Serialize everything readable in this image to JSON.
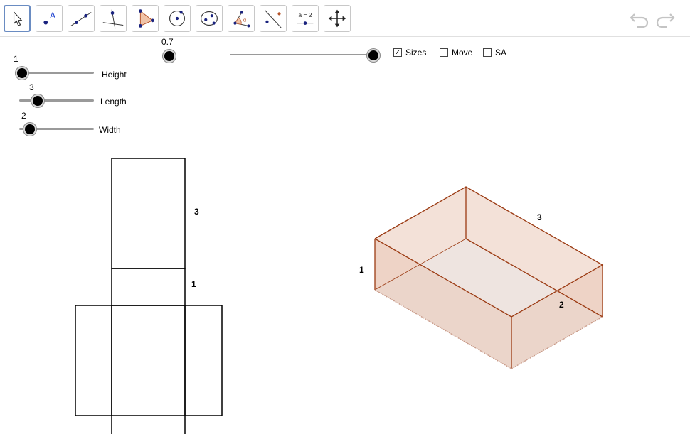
{
  "toolbar": {
    "tools": [
      {
        "name": "move-tool",
        "label": ""
      },
      {
        "name": "point-tool",
        "label": "A"
      },
      {
        "name": "line-tool",
        "label": ""
      },
      {
        "name": "perpendicular-line-tool",
        "label": ""
      },
      {
        "name": "polygon-tool",
        "label": ""
      },
      {
        "name": "circle-tool",
        "label": ""
      },
      {
        "name": "ellipse-tool",
        "label": ""
      },
      {
        "name": "angle-tool",
        "label": "α"
      },
      {
        "name": "reflect-tool",
        "label": ""
      },
      {
        "name": "slider-tool",
        "label": "a = 2"
      },
      {
        "name": "move-graphics-view-tool",
        "label": ""
      }
    ],
    "undo_icon": "undo-icon",
    "redo_icon": "redo-icon"
  },
  "sliders": {
    "height": {
      "label": "Height",
      "value": "1"
    },
    "length": {
      "label": "Length",
      "value": "3"
    },
    "width": {
      "label": "Width",
      "value": "2"
    },
    "unfold": {
      "value": "0.7"
    }
  },
  "checkboxes": {
    "sizes": {
      "label": "Sizes",
      "checked": true,
      "mark": "✓"
    },
    "move": {
      "label": "Move",
      "checked": false,
      "mark": ""
    },
    "sa": {
      "label": "SA",
      "checked": false,
      "mark": ""
    }
  },
  "net_labels": {
    "top": "3",
    "middle": "1"
  },
  "box_labels": {
    "height": "1",
    "length": "3",
    "width": "2"
  },
  "colors": {
    "box_edge": "#9b3a12",
    "box_face": "#e9c9b8",
    "accent": "#6a8cc2"
  }
}
